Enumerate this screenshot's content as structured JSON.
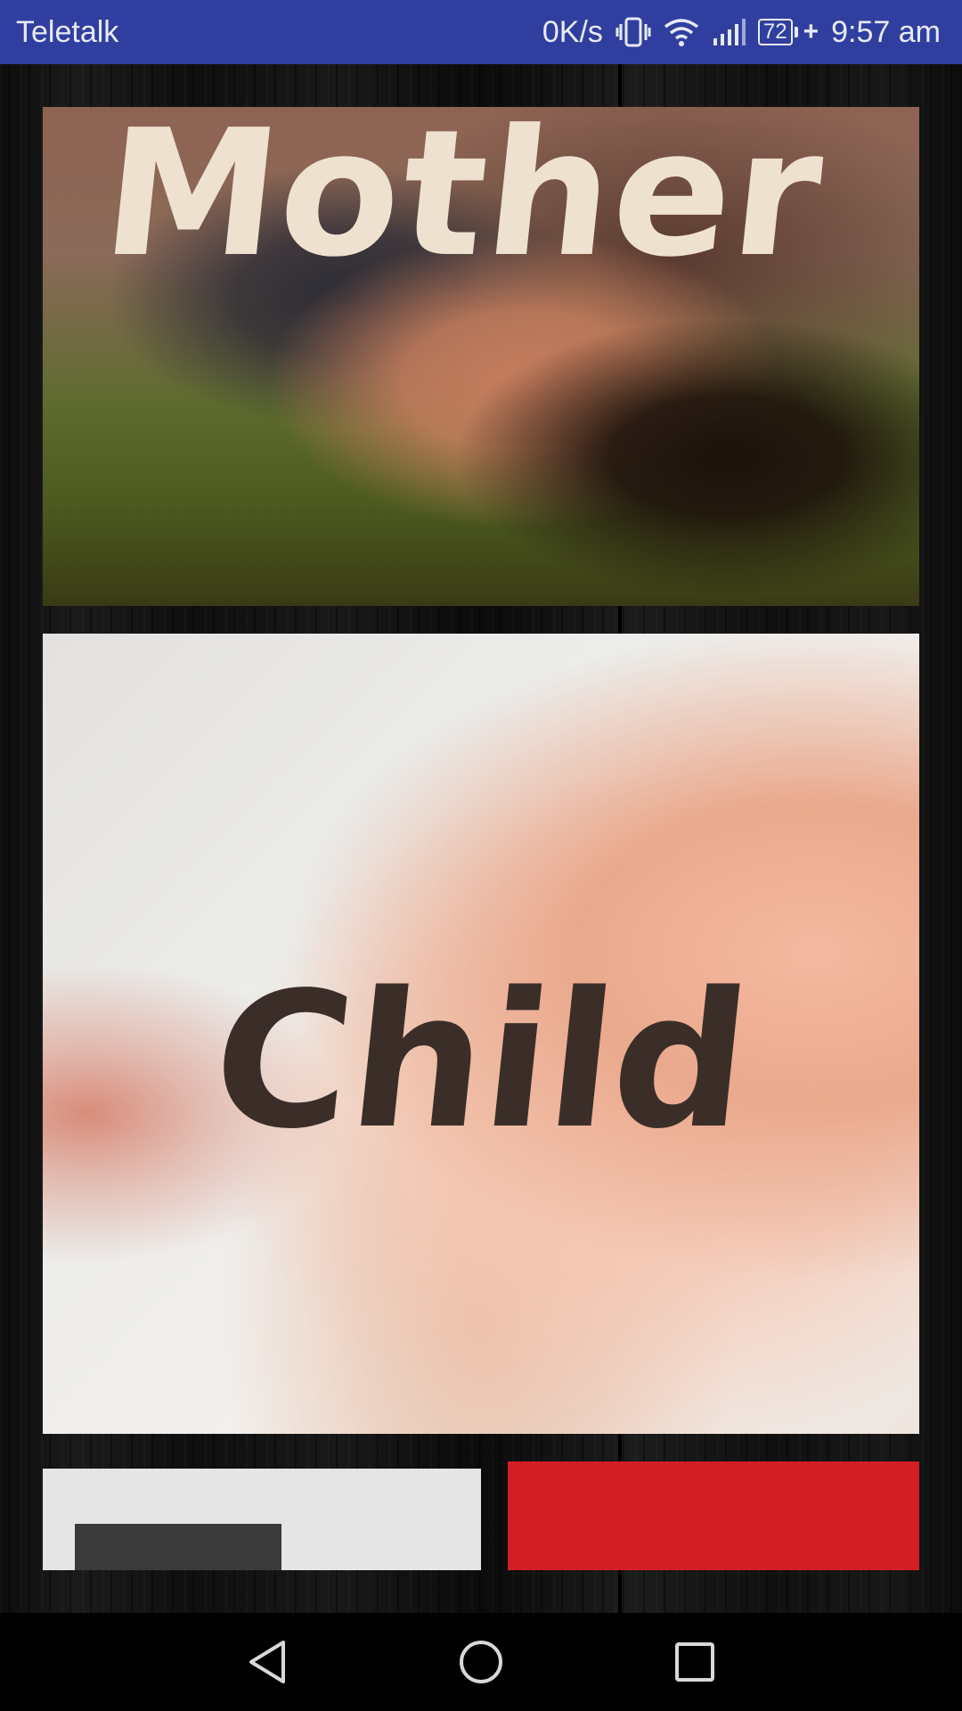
{
  "status_bar": {
    "carrier": "Teletalk",
    "net_speed": "0K/s",
    "battery": "72",
    "time": "9:57 am",
    "icons": [
      "vibrate-icon",
      "wifi-icon",
      "signal-icon",
      "battery-icon"
    ]
  },
  "cards": {
    "mother": {
      "label": "Mother"
    },
    "child": {
      "label": "Child"
    }
  },
  "nav": {
    "back": "back-icon",
    "home": "home-icon",
    "recents": "recents-icon"
  },
  "colors": {
    "status_bar": "#303f9f",
    "red_tile": "#d41e26",
    "grey_tile": "#e5e5e5"
  }
}
